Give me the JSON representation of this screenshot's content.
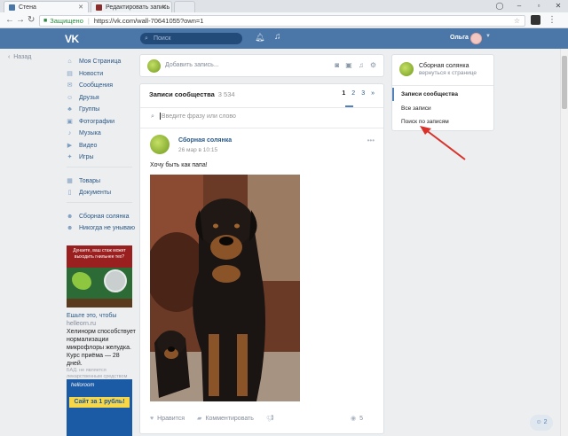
{
  "browser": {
    "tabs": [
      {
        "label": "Стена",
        "active": true
      },
      {
        "label": "Редактировать запись",
        "active": false
      }
    ],
    "secure_label": "Защищено",
    "url": "https://vk.com/wall-70641055?own=1"
  },
  "header": {
    "logo": "VK",
    "search_placeholder": "Поиск",
    "user_name": "Ольга"
  },
  "left": {
    "back_label": "Назад",
    "menu": [
      {
        "label": "Моя Страница",
        "icon": "home-icon"
      },
      {
        "label": "Новости",
        "icon": "news-icon"
      },
      {
        "label": "Сообщения",
        "icon": "messages-icon"
      },
      {
        "label": "Друзья",
        "icon": "friends-icon"
      },
      {
        "label": "Группы",
        "icon": "groups-icon"
      },
      {
        "label": "Фотографии",
        "icon": "photos-icon"
      },
      {
        "label": "Музыка",
        "icon": "music-icon"
      },
      {
        "label": "Видео",
        "icon": "video-icon"
      },
      {
        "label": "Игры",
        "icon": "games-icon"
      }
    ],
    "menu2": [
      {
        "label": "Товары",
        "icon": "goods-icon"
      },
      {
        "label": "Документы",
        "icon": "docs-icon"
      }
    ],
    "menu3": [
      {
        "label": "Сборная солянка",
        "icon": "community-icon"
      },
      {
        "label": "Никогда не унываю",
        "icon": "community-icon"
      }
    ],
    "ad1": {
      "banner_text": "Дунаете, ваш стаж может выходить гнильнее тех?",
      "title": "Ешьте это, чтобы",
      "source": "helleorn.ru",
      "body": "Хелинорм способствует нормализации микрофлоры желудка. Курс приёма — 28 дней.",
      "foot": "БАД. не является лекарственным средством"
    },
    "ad2": {
      "brand": "helloroom",
      "promo": "Сайт за 1 рубль!"
    }
  },
  "composer": {
    "placeholder": "Добавить запись..."
  },
  "wall": {
    "title": "Записи сообщества",
    "count": "3 534",
    "pages": [
      "1",
      "2",
      "3",
      "»"
    ],
    "search_placeholder": "Введите фразу или слово"
  },
  "post": {
    "author": "Сборная солянка",
    "date": "26 мар в 10:15",
    "text": "Хочу быть как папа!",
    "like_label": "Нравится",
    "comment_label": "Комментировать",
    "views": "5"
  },
  "right": {
    "name": "Сборная солянка",
    "sub": "вернуться к странице",
    "items": [
      {
        "label": "Записи сообщества",
        "active": true
      },
      {
        "label": "Все записи",
        "active": false
      },
      {
        "label": "Поиск по записям",
        "active": false
      }
    ]
  },
  "chat": {
    "count": "2"
  },
  "colors": {
    "vk_header": "#4a76a8",
    "link": "#2a5885",
    "arrow": "#d9322a",
    "background": "#edeef0"
  }
}
